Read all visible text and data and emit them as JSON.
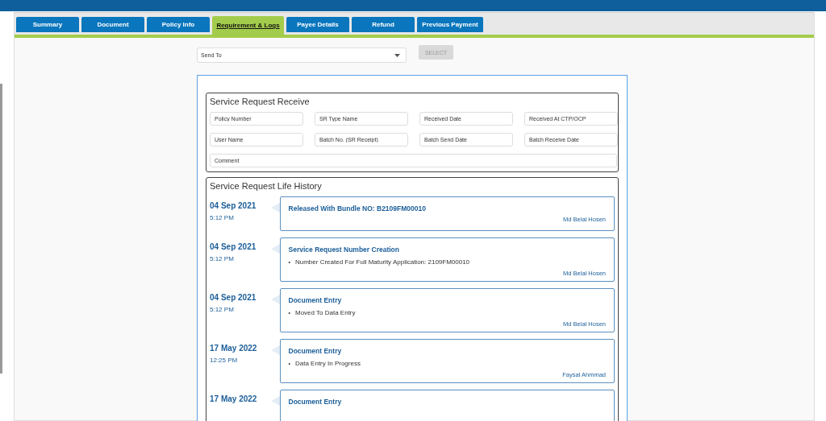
{
  "tabs": [
    {
      "label": "Summary",
      "selected": false
    },
    {
      "label": "Document",
      "selected": false
    },
    {
      "label": "Policy Info",
      "selected": false
    },
    {
      "label": "Requirement & Logs",
      "selected": true
    },
    {
      "label": "Payee Details",
      "selected": false
    },
    {
      "label": "Refund",
      "selected": false
    },
    {
      "label": "Previous Payment",
      "selected": false
    }
  ],
  "send_to": {
    "placeholder": "Send To"
  },
  "select_button": {
    "label": "SELECT",
    "disabled": true
  },
  "service_request_receive": {
    "title": "Service Request Receive",
    "fields": [
      {
        "placeholder": "Policy Number"
      },
      {
        "placeholder": "SR Type Name"
      },
      {
        "placeholder": "Received Date"
      },
      {
        "placeholder": "Received At CTP/OCP"
      },
      {
        "placeholder": "User Name"
      },
      {
        "placeholder": "Batch No. (SR Receipt)"
      },
      {
        "placeholder": "Batch Send Date"
      },
      {
        "placeholder": "Batch Receive Date"
      }
    ],
    "comment": {
      "placeholder": "Comment"
    }
  },
  "life_history": {
    "title": "Service Request Life History",
    "entries": [
      {
        "date": "04 Sep 2021",
        "time": "5:12 PM",
        "title": "Released With Bundle NO: B2109FM00010",
        "user": "Md Belal Hosen"
      },
      {
        "date": "04 Sep 2021",
        "time": "5:12 PM",
        "title": "Service Request Number Creation",
        "items": [
          {
            "bullet": "•",
            "text": "Number Created For Full Maturity Application: 2109FM00010"
          }
        ],
        "user": "Md Belal Hosen"
      },
      {
        "date": "04 Sep 2021",
        "time": "5:12 PM",
        "title": "Document Entry",
        "items": [
          {
            "bullet": "•",
            "text": "Moved To Data Entry"
          }
        ],
        "user": "Md Belal Hosen"
      },
      {
        "date": "17 May 2022",
        "time": "12:25 PM",
        "title": "Document Entry",
        "items": [
          {
            "bullet": "•",
            "text": "Data Entry In Progress"
          }
        ],
        "user": "Faysal Ahmmad"
      },
      {
        "date": "17 May 2022",
        "title": "Document Entry"
      }
    ]
  }
}
